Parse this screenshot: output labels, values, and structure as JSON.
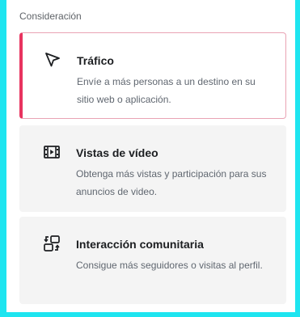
{
  "section": {
    "label": "Consideración"
  },
  "options": [
    {
      "title": "Tráfico",
      "description": "Envíe a más personas a un destino en su sitio web o aplicación.",
      "icon": "cursor-arrow-icon",
      "selected": true
    },
    {
      "title": "Vistas de vídeo",
      "description": "Obtenga más vistas y participación para sus anuncios de video.",
      "icon": "video-film-icon",
      "selected": false
    },
    {
      "title": "Interacción comunitaria",
      "description": "Consigue más seguidores o visitas al perfil.",
      "icon": "community-exchange-icon",
      "selected": false
    }
  ],
  "colors": {
    "selected_accent": "#e8335f",
    "card_background": "#f4f4f4",
    "page_background": "#1ee5f0"
  }
}
